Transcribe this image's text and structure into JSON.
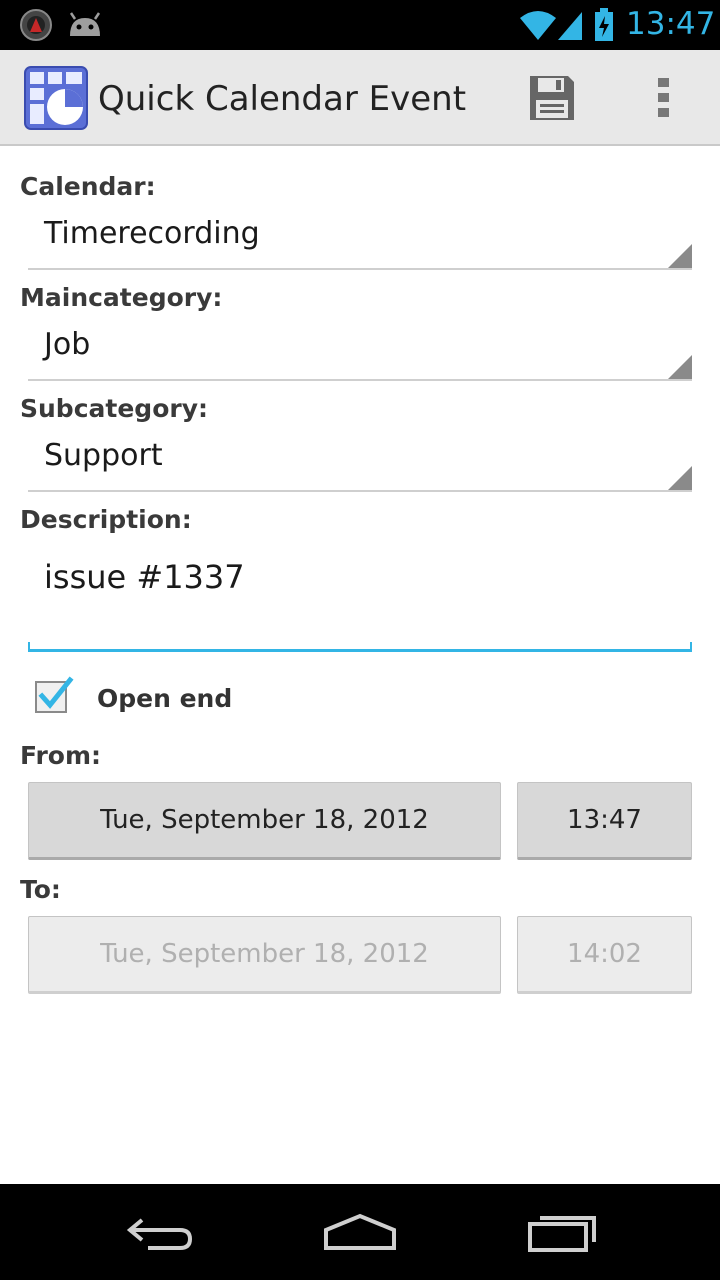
{
  "status_bar": {
    "time": "13:47",
    "icons": [
      "notification-app-icon",
      "android-icon",
      "wifi-icon",
      "signal-icon",
      "battery-charging-icon"
    ],
    "accent_color": "#33b5e5"
  },
  "action_bar": {
    "title": "Quick Calendar Event",
    "app_icon": "calendar-app-icon",
    "actions": [
      "save-icon",
      "overflow-menu-icon"
    ]
  },
  "form": {
    "calendar": {
      "label": "Calendar:",
      "value": "Timerecording"
    },
    "maincategory": {
      "label": "Maincategory:",
      "value": "Job"
    },
    "subcategory": {
      "label": "Subcategory:",
      "value": "Support"
    },
    "description": {
      "label": "Description:",
      "value": "issue #1337"
    },
    "open_end": {
      "label": "Open end",
      "checked": true
    },
    "from": {
      "label": "From:",
      "date": "Tue, September 18, 2012",
      "time": "13:47"
    },
    "to": {
      "label": "To:",
      "date": "Tue, September 18, 2012",
      "time": "14:02",
      "disabled": true
    }
  },
  "nav_bar": {
    "buttons": [
      "back-icon",
      "home-icon",
      "recent-apps-icon"
    ]
  }
}
